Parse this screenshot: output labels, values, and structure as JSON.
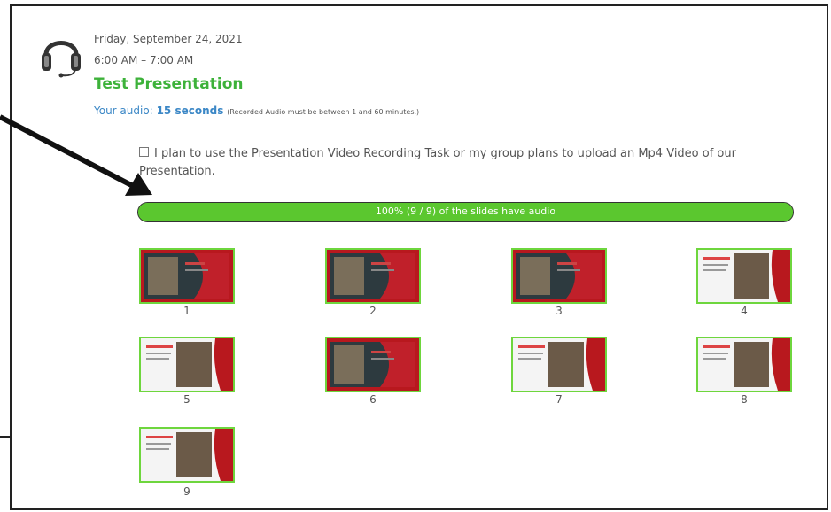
{
  "event": {
    "date": "Friday, September 24, 2021",
    "time": "6:00 AM – 7:00 AM",
    "title": "Test Presentation",
    "audio_prefix": "Your audio:",
    "audio_duration": "15 seconds",
    "audio_note": "(Recorded Audio must be between 1 and 60 minutes.)"
  },
  "plan_checkbox": {
    "checked": false,
    "label": "I plan to use the Presentation Video Recording Task or my group plans to upload an Mp4 Video of our Presentation."
  },
  "progress": {
    "fraction": 1.0,
    "label": "100% (9 / 9) of the slides have audio",
    "color": "#5bc72f"
  },
  "slides": [
    {
      "number": "1",
      "theme": "dark-red"
    },
    {
      "number": "2",
      "theme": "dark-red"
    },
    {
      "number": "3",
      "theme": "dark-red"
    },
    {
      "number": "4",
      "theme": "light"
    },
    {
      "number": "5",
      "theme": "light"
    },
    {
      "number": "6",
      "theme": "dark-red"
    },
    {
      "number": "7",
      "theme": "light"
    },
    {
      "number": "8",
      "theme": "light"
    },
    {
      "number": "9",
      "theme": "light"
    }
  ],
  "colors": {
    "title_green": "#3db23a",
    "audio_blue": "#3b87c6",
    "thumb_border": "#6ed63d"
  }
}
